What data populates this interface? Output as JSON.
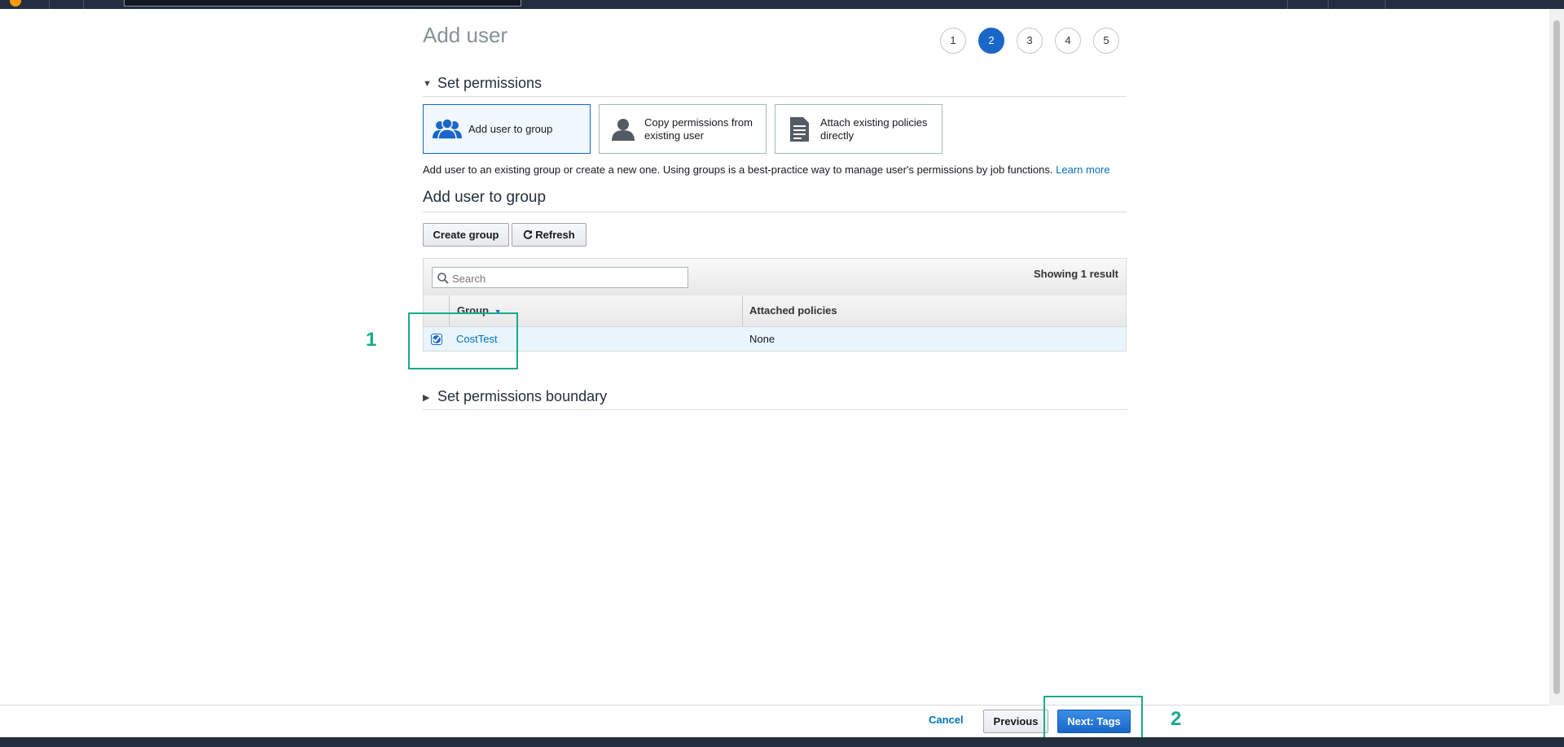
{
  "page_title": "Add user",
  "steps": [
    {
      "label": "1",
      "active": false
    },
    {
      "label": "2",
      "active": true
    },
    {
      "label": "3",
      "active": false
    },
    {
      "label": "4",
      "active": false
    },
    {
      "label": "5",
      "active": false
    }
  ],
  "set_permissions": {
    "heading": "Set permissions",
    "options": [
      {
        "label": "Add user to group",
        "icon": "group-icon",
        "selected": true
      },
      {
        "label": "Copy permissions from existing user",
        "icon": "user-icon",
        "selected": false
      },
      {
        "label": "Attach existing policies directly",
        "icon": "document-icon",
        "selected": false
      }
    ],
    "description": "Add user to an existing group or create a new one. Using groups is a best-practice way to manage user's permissions by job functions.",
    "learn_more": "Learn more"
  },
  "add_to_group": {
    "heading": "Add user to group",
    "create_group_label": "Create group",
    "refresh_label": "Refresh",
    "search_placeholder": "Search",
    "showing": "Showing 1 result",
    "columns": [
      "Group",
      "Attached policies"
    ],
    "rows": [
      {
        "group": "CostTest",
        "policies": "None",
        "checked": true
      }
    ]
  },
  "boundary_heading": "Set permissions boundary",
  "footer": {
    "cancel": "Cancel",
    "previous": "Previous",
    "next": "Next: Tags"
  },
  "annotations": [
    "1",
    "2"
  ],
  "colors": {
    "accent": "#1b66c9",
    "link": "#0073bb",
    "annotation": "#1aaa8a",
    "nav": "#232f3e"
  }
}
